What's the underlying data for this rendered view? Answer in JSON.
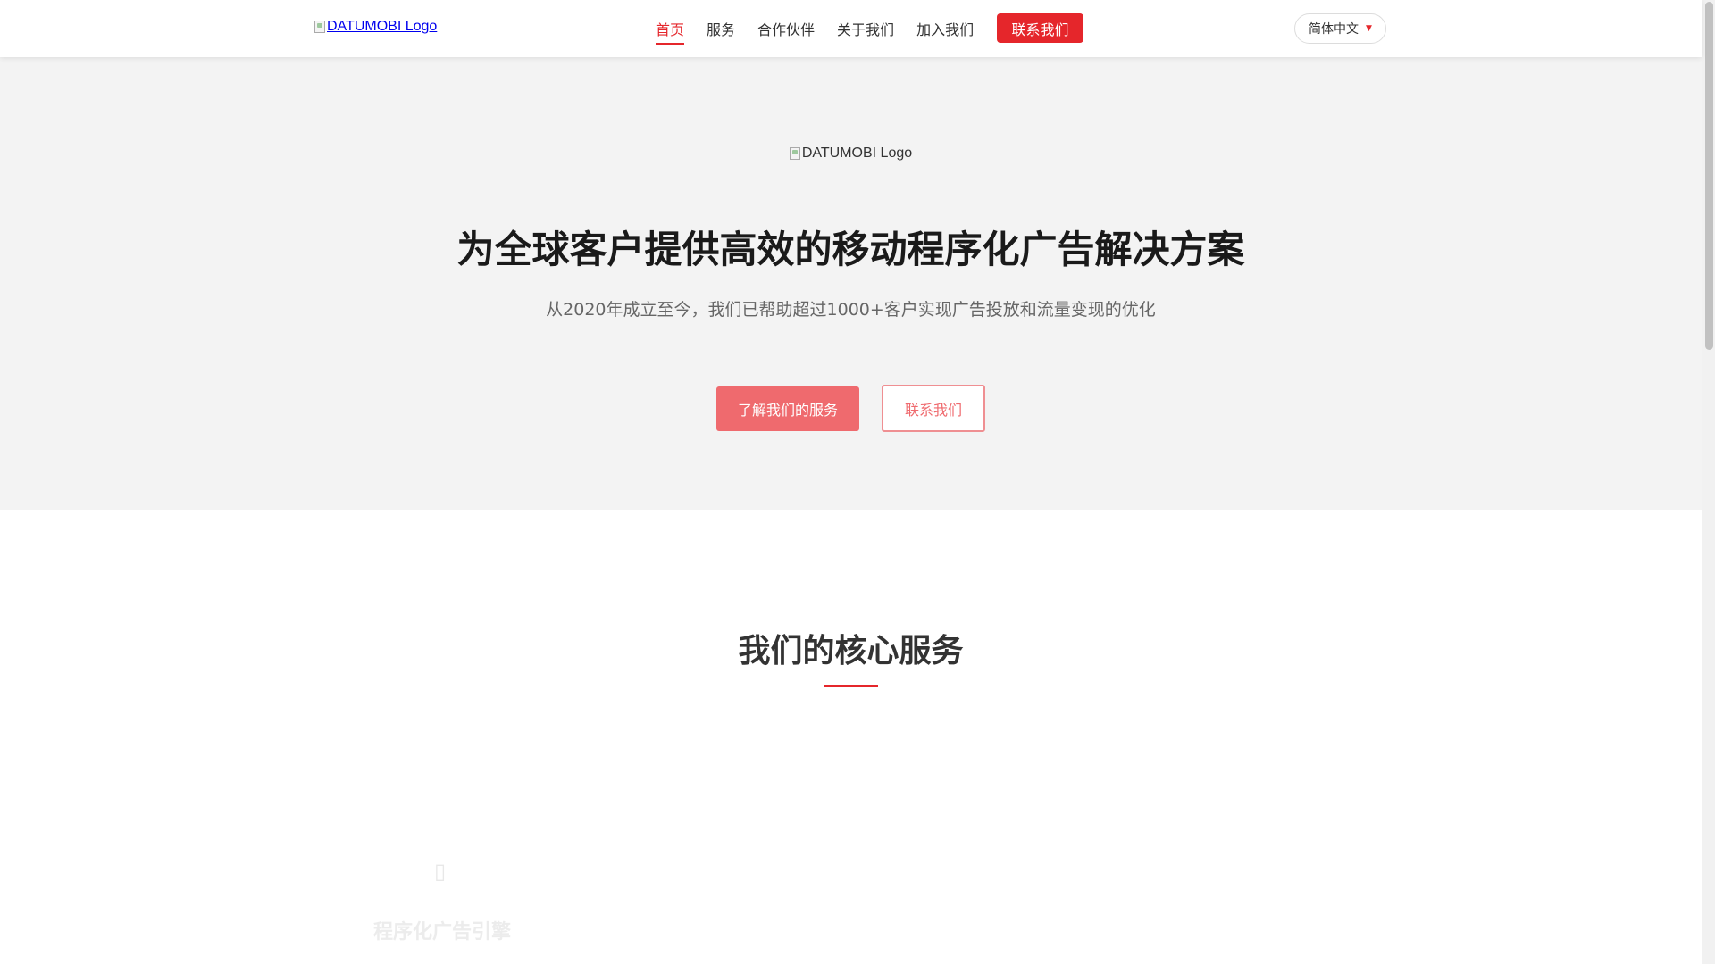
{
  "nav": {
    "logo_alt": "DATUMOBI Logo",
    "links": [
      {
        "label": "首页",
        "active": true
      },
      {
        "label": "服务",
        "active": false
      },
      {
        "label": "合作伙伴",
        "active": false
      },
      {
        "label": "关于我们",
        "active": false
      },
      {
        "label": "加入我们",
        "active": false
      }
    ],
    "contact_label": "联系我们",
    "language": {
      "selected": "简体中文",
      "caret": "▼"
    }
  },
  "hero": {
    "logo_alt": "DATUMOBI Logo",
    "title": "为全球客户提供高效的移动程序化广告解决方案",
    "subtitle": "从2020年成立至今，我们已帮助超过1000+客户实现广告投放和流量变现的优化",
    "primary_button": "了解我们的服务",
    "secondary_button": "联系我们"
  },
  "services": {
    "title": "我们的核心服务",
    "items": [
      {
        "icon": "placeholder-icon",
        "name": "程序化广告引擎"
      }
    ]
  },
  "colors": {
    "accent": "#e5262b",
    "hero_bg": "#f3f3f3",
    "primary_button": "#ef6a6e"
  }
}
